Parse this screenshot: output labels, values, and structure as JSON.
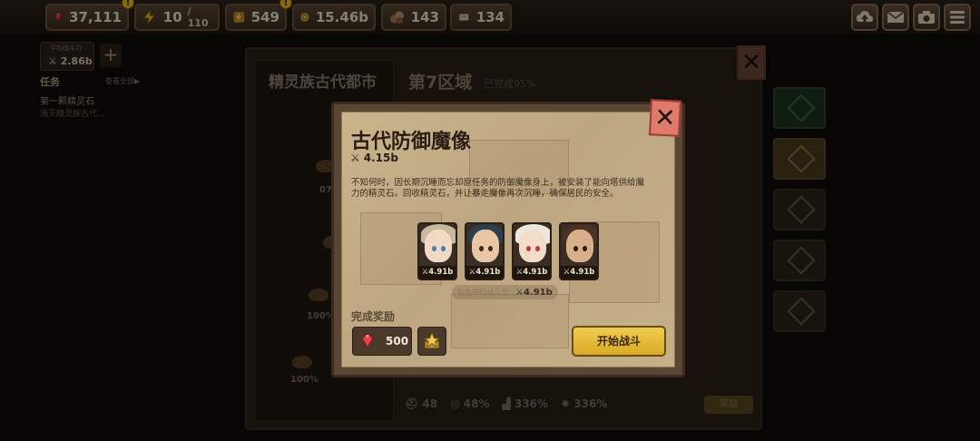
{
  "resources": {
    "gems": "37,111",
    "energy": "10",
    "energy_max": "/ 110",
    "power_bolt": "549",
    "gold": "15.46b",
    "ore": "143",
    "scroll": "134"
  },
  "system_buttons": [
    "upload-icon",
    "mail-icon",
    "camera-icon",
    "menu-icon"
  ],
  "left": {
    "team_power_label": "平均战斗力",
    "team_power": "2.86b",
    "task_header": "任务",
    "task_view_all": "查看全部▶",
    "task_name": "第一颗精灵石",
    "task_detail": "消灭精灵族古代..."
  },
  "background": {
    "map_title": "精灵族古代都市",
    "zone_title": "第7区域",
    "zone_progress": "已完成95%",
    "map_pcts": [
      "07",
      "100%",
      "100%"
    ],
    "stats": [
      {
        "icon": "helmet-icon",
        "value": "48"
      },
      {
        "icon": "coin-icon",
        "value": "48%"
      },
      {
        "icon": "boot-icon",
        "value": "336%"
      },
      {
        "icon": "gear-icon",
        "value": "336%"
      }
    ],
    "bottom_button": "奖励"
  },
  "dialog": {
    "title": "古代防御魔像",
    "power": "4.15b",
    "description": "不知何时，因长期沉睡而忘却原任务的防御魔像身上，被安装了能向塔供给魔力的精灵石。回收精灵石，并让暴走魔像再次沉睡，确保居民的安全。",
    "heroes": [
      {
        "power": "4.91b"
      },
      {
        "power": "4.91b"
      },
      {
        "power": "4.91b"
      },
      {
        "power": "4.91b"
      }
    ],
    "avg_label": "队伍平均战斗力",
    "avg_power": "4.91b",
    "reward_label": "完成奖励",
    "reward_amount": "500",
    "start_button": "开始战斗",
    "close": "✕"
  },
  "colors": {
    "gem": "#e0434a",
    "energy": "#f3c316",
    "gold": "#e0b13c",
    "start_button": "#e8bf3d",
    "close_button": "#e07a6a"
  }
}
